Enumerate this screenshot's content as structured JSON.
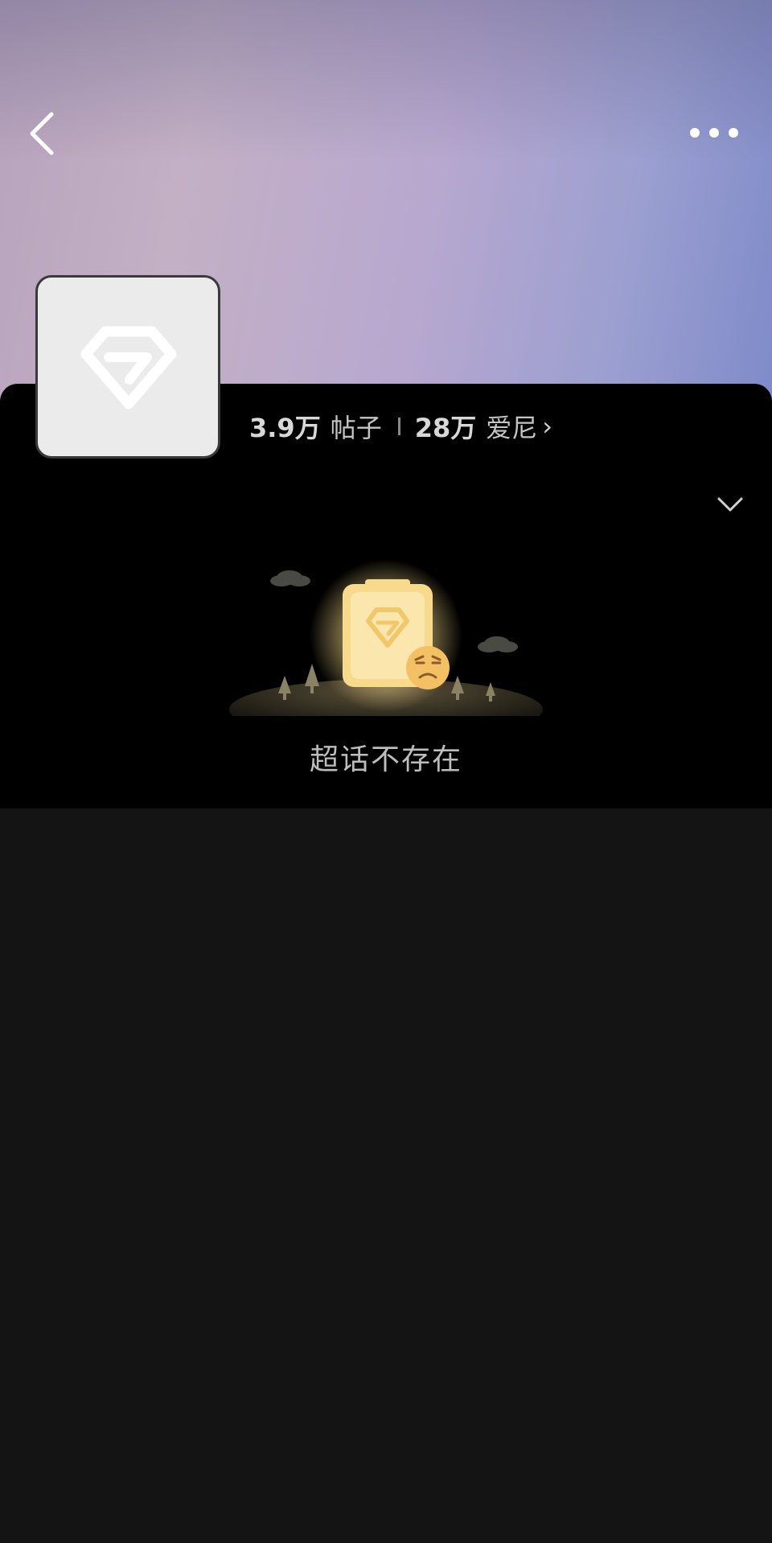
{
  "header": {
    "back_icon": "chevron-left-icon",
    "more_icon": "more-dots-icon"
  },
  "topic": {
    "avatar_icon": "diamond-icon",
    "posts_count": "3.9万",
    "posts_label": "帖子",
    "fans_count": "28万",
    "fans_label": "爱尼",
    "fans_chevron": "›"
  },
  "expand_icon": "chevron-down-icon",
  "empty_state": {
    "illustration_icon": "sad-topic-icon",
    "message": "超话不存在"
  },
  "colors": {
    "panel_bg": "#000000",
    "lower_bg": "#141414",
    "illustration_accent": "#f6d98a"
  }
}
